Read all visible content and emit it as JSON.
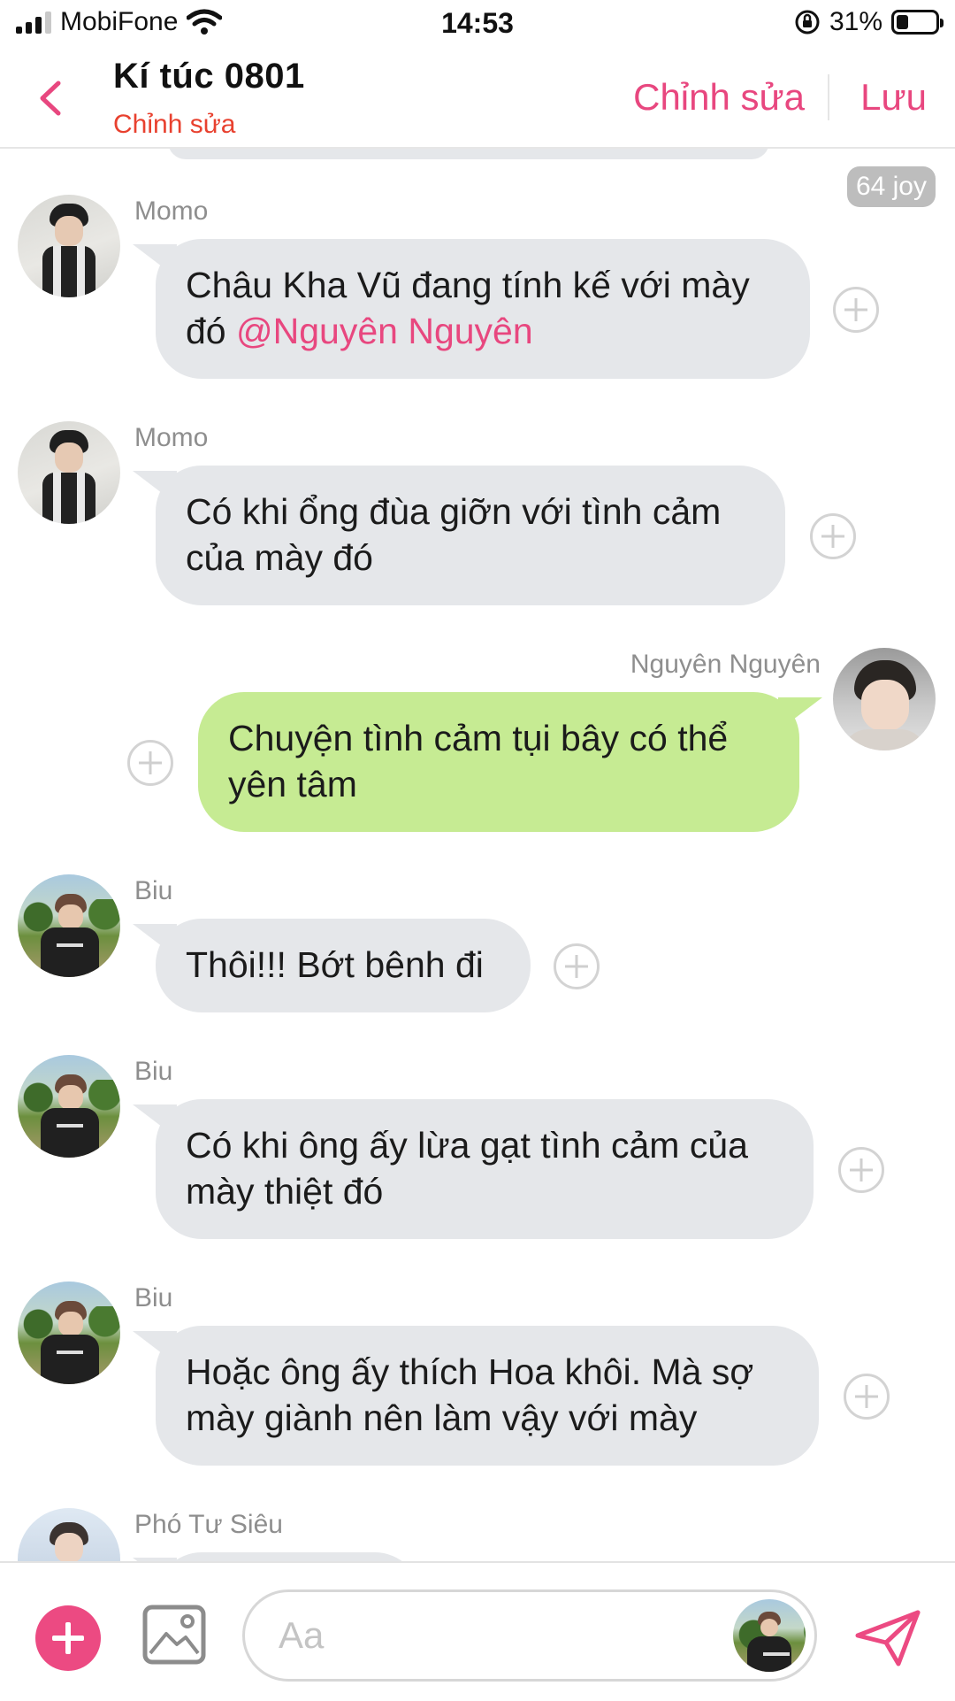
{
  "status_bar": {
    "carrier": "MobiFone",
    "time": "14:53",
    "battery": "31%",
    "battery_level": 0.31
  },
  "header": {
    "title": "Kí túc 0801",
    "subtitle": "Chỉnh sửa",
    "edit_label": "Chỉnh sửa",
    "save_label": "Lưu",
    "accent_color": "#e8477f"
  },
  "badge": {
    "label": "64 joy"
  },
  "messages": [
    {
      "sender": "Momo",
      "text": "Châu Kha Vũ đang tính kế với mày đó ",
      "mention": "@Nguyên Nguyên",
      "mine": false
    },
    {
      "sender": "Momo",
      "text": "Có khi ổng đùa giỡn với tình cảm của mày đó",
      "mine": false
    },
    {
      "sender": "Nguyên Nguyên",
      "text": "Chuyện tình cảm tụi bây có thể yên tâm",
      "mine": true
    },
    {
      "sender": "Biu",
      "text": "Thôi!!! Bớt bênh đi",
      "mine": false
    },
    {
      "sender": "Biu",
      "text": "Có khi ông ấy lừa gạt tình cảm của mày thiệt đó",
      "mine": false
    },
    {
      "sender": "Biu",
      "text": "Hoặc ông ấy thích Hoa khôi. Mà sợ mày giành nên làm vậy với mày",
      "mine": false
    },
    {
      "sender": "Phó Tư Siêu",
      "text": "",
      "mine": false
    }
  ],
  "composer": {
    "placeholder": "Aa"
  },
  "icons": {
    "back": "chevron-left-icon",
    "add": "plus-icon",
    "image": "image-icon",
    "send": "send-icon",
    "react": "add-reaction-icon"
  }
}
